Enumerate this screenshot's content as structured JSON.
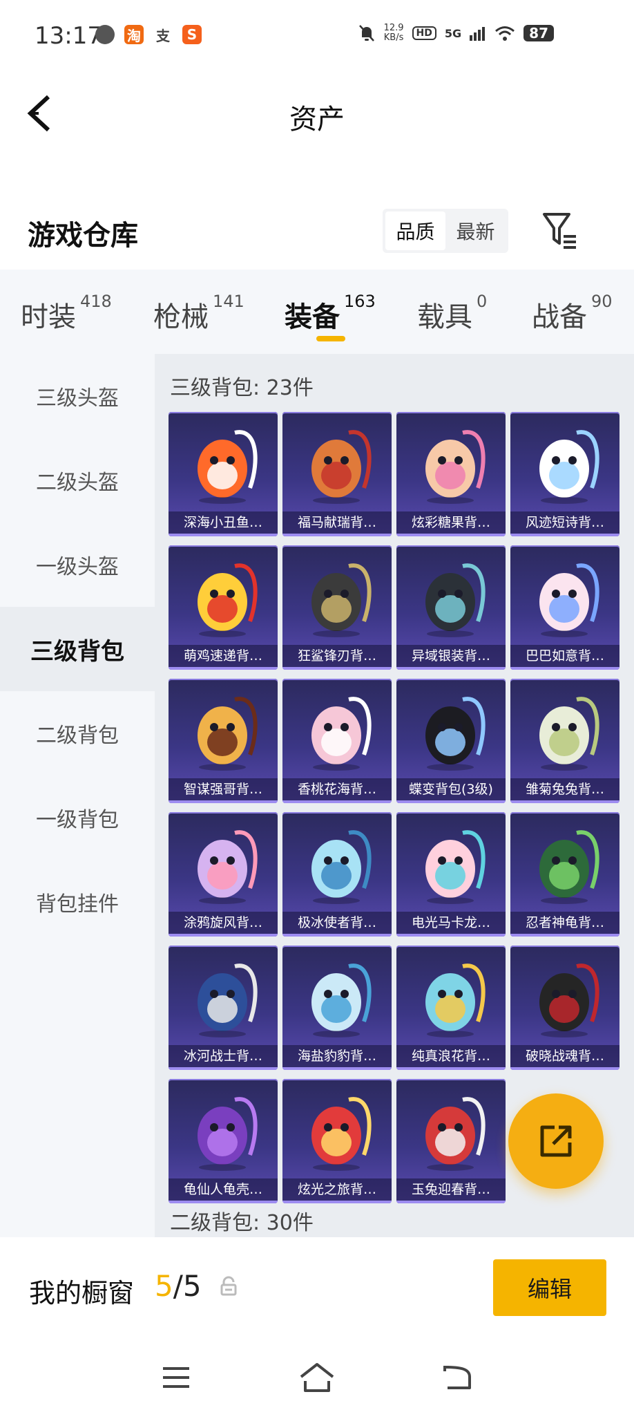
{
  "status_bar": {
    "time": "13:17",
    "speed_top": "12.9",
    "speed_unit": "KB/s",
    "hd": "HD",
    "network": "5G",
    "battery": "87",
    "app_icons": [
      "淘",
      "支",
      "S"
    ]
  },
  "header": {
    "title": "资产"
  },
  "section": {
    "title": "游戏仓库",
    "sort_options": [
      "品质",
      "最新"
    ],
    "active_sort": 0
  },
  "category_tabs": [
    {
      "label": "时装",
      "count": "418"
    },
    {
      "label": "枪械",
      "count": "141"
    },
    {
      "label": "装备",
      "count": "163",
      "active": true
    },
    {
      "label": "载具",
      "count": "0"
    },
    {
      "label": "战备",
      "count": "90"
    }
  ],
  "sidebar": {
    "items": [
      "三级头盔",
      "二级头盔",
      "一级头盔",
      "三级背包",
      "二级背包",
      "一级背包",
      "背包挂件"
    ],
    "active_index": 3
  },
  "content": {
    "groups": [
      {
        "label": "三级背包: 23件",
        "items": [
          "深海小丑鱼…",
          "福马献瑞背…",
          "炫彩糖果背…",
          "风迹短诗背…",
          "萌鸡速递背…",
          "狂鲨锋刃背…",
          "异域银装背…",
          "巴巴如意背…",
          "智谋强哥背…",
          "香桃花海背…",
          "蝶变背包(3级)",
          "雏菊兔兔背…",
          "涂鸦旋风背…",
          "极冰使者背…",
          "电光马卡龙…",
          "忍者神龟背…",
          "冰河战士背…",
          "海盐豹豹背…",
          "纯真浪花背…",
          "破晓战魂背…",
          "龟仙人龟壳…",
          "炫光之旅背…",
          "玉兔迎春背…"
        ]
      },
      {
        "label": "二级背包: 30件"
      }
    ]
  },
  "showcase": {
    "label": "我的橱窗",
    "current": "5",
    "separator": "/",
    "total": "5",
    "edit_label": "编辑"
  },
  "colors": {
    "accent": "#f5b400",
    "fab": "#f5ae12",
    "card_top": "#2c2a5e",
    "card_bottom": "#5a4bb0",
    "sidebar_bg": "#f5f7fa",
    "content_bg": "#eaedf1"
  },
  "icons": {
    "back": "chevron-left-icon",
    "filter": "filter-icon",
    "share": "share-external-icon",
    "lock": "lock-icon",
    "nav": [
      "menu-icon",
      "home-icon",
      "back-nav-icon"
    ]
  }
}
